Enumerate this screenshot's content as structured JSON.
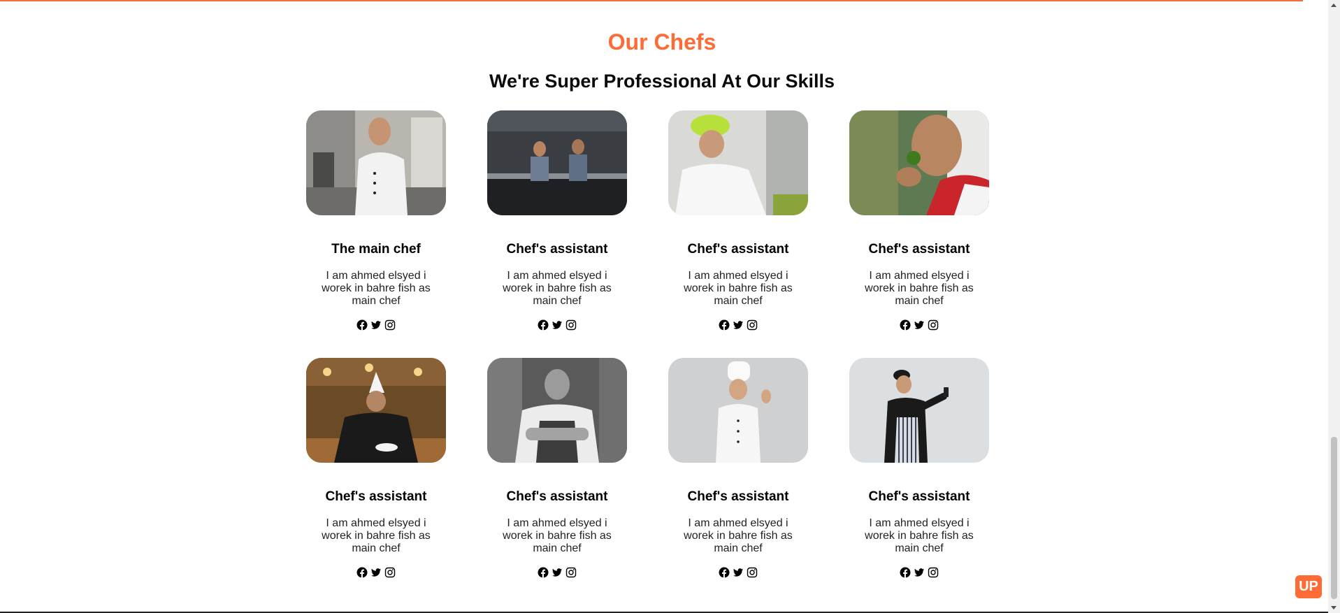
{
  "section": {
    "title": "Our Chefs",
    "subtitle": "We're Super Professional At Our Skills"
  },
  "chefs": [
    {
      "title": "The main chef",
      "bio": "I am ahmed elsyed i worek in bahre fish as main chef",
      "photo_icon": "chef-white-coat-photo"
    },
    {
      "title": "Chef's assistant",
      "bio": "I am ahmed elsyed i worek in bahre fish as main chef",
      "photo_icon": "two-chefs-kitchen-photo"
    },
    {
      "title": "Chef's assistant",
      "bio": "I am ahmed elsyed i worek in bahre fish as main chef",
      "photo_icon": "chef-green-hat-photo"
    },
    {
      "title": "Chef's assistant",
      "bio": "I am ahmed elsyed i worek in bahre fish as main chef",
      "photo_icon": "chef-smelling-herb-photo"
    },
    {
      "title": "Chef's assistant",
      "bio": "I am ahmed elsyed i worek in bahre fish as main chef",
      "photo_icon": "chef-tall-hat-restaurant-photo"
    },
    {
      "title": "Chef's assistant",
      "bio": "I am ahmed elsyed i worek in bahre fish as main chef",
      "photo_icon": "chef-apron-arms-crossed-photo"
    },
    {
      "title": "Chef's assistant",
      "bio": "I am ahmed elsyed i worek in bahre fish as main chef",
      "photo_icon": "chef-ok-sign-photo"
    },
    {
      "title": "Chef's assistant",
      "bio": "I am ahmed elsyed i worek in bahre fish as main chef",
      "photo_icon": "chef-striped-apron-phone-photo"
    }
  ],
  "social_icons": [
    "facebook-icon",
    "twitter-icon",
    "instagram-icon"
  ],
  "up_button": {
    "label": "UP"
  },
  "colors": {
    "accent": "#ff6b35",
    "text": "#0a0a0a"
  }
}
